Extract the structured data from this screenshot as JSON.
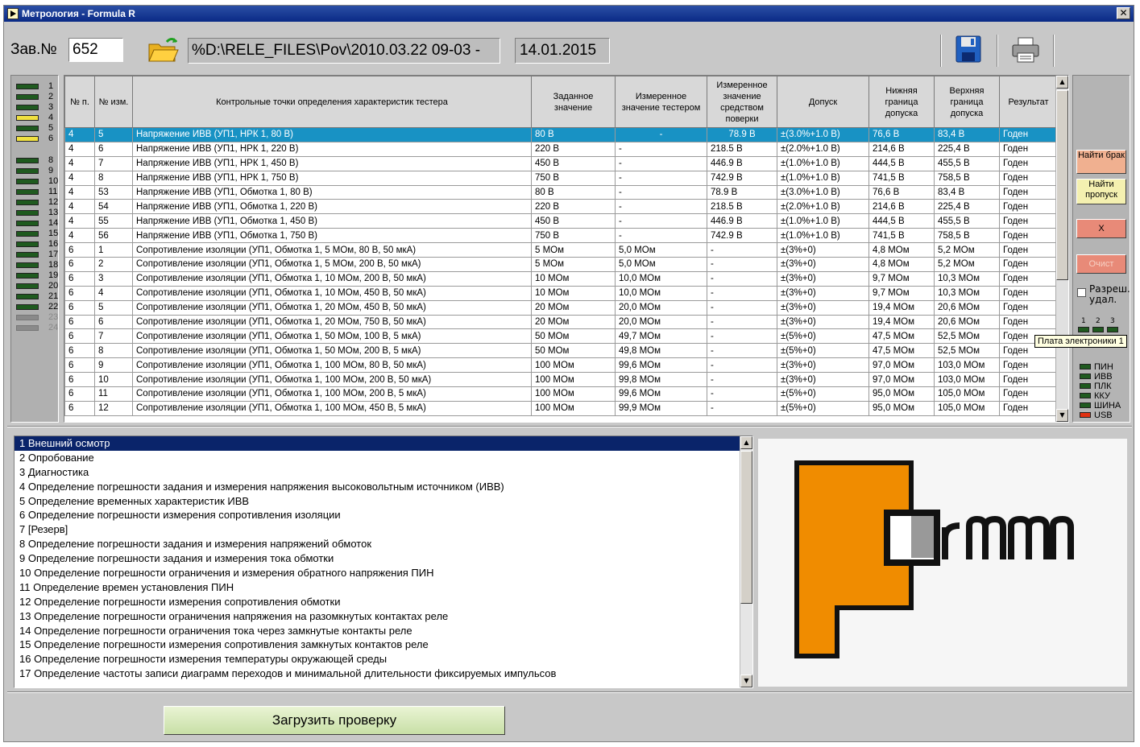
{
  "window": {
    "title": "Метрология - Formula R"
  },
  "toolbar": {
    "zav_label": "Зав.№",
    "zav_value": "652",
    "path": "%D:\\RELE_FILES\\Pov\\2010.03.22 09-03 -",
    "date": "14.01.2015"
  },
  "leds": [
    {
      "num": "1",
      "color": "green"
    },
    {
      "num": "2",
      "color": "green"
    },
    {
      "num": "3",
      "color": "green"
    },
    {
      "num": "4",
      "color": "yellow"
    },
    {
      "num": "5",
      "color": "green"
    },
    {
      "num": "6",
      "color": "yellow"
    },
    {
      "num": "8",
      "color": "green"
    },
    {
      "num": "9",
      "color": "green"
    },
    {
      "num": "10",
      "color": "green"
    },
    {
      "num": "11",
      "color": "green"
    },
    {
      "num": "12",
      "color": "green"
    },
    {
      "num": "13",
      "color": "green"
    },
    {
      "num": "14",
      "color": "green"
    },
    {
      "num": "15",
      "color": "green"
    },
    {
      "num": "16",
      "color": "green"
    },
    {
      "num": "17",
      "color": "green"
    },
    {
      "num": "18",
      "color": "green"
    },
    {
      "num": "19",
      "color": "green"
    },
    {
      "num": "20",
      "color": "green"
    },
    {
      "num": "21",
      "color": "green"
    },
    {
      "num": "22",
      "color": "green"
    },
    {
      "num": "23",
      "color": "gray"
    },
    {
      "num": "24",
      "color": "gray"
    }
  ],
  "table": {
    "headers": [
      "№ п.",
      "№ изм.",
      "Контрольные точки определения характеристик тестера",
      "Заданное значение",
      "Измеренное значение тестером",
      "Измеренное значение средством поверки",
      "Допуск",
      "Нижняя граница допуска",
      "Верхняя граница допуска",
      "Результат"
    ],
    "rows": [
      [
        "4",
        "5",
        "Напряжение ИВВ (УП1, НРК 1, 80 В)",
        "80 В",
        "-",
        "78.9 В",
        "±(3.0%+1.0 В)",
        "76,6 В",
        "83,4 В",
        "Годен"
      ],
      [
        "4",
        "6",
        "Напряжение ИВВ (УП1, НРК 1, 220 В)",
        "220 В",
        "-",
        "218.5 В",
        "±(2.0%+1.0 В)",
        "214,6 В",
        "225,4 В",
        "Годен"
      ],
      [
        "4",
        "7",
        "Напряжение ИВВ (УП1, НРК 1, 450 В)",
        "450 В",
        "-",
        "446.9 В",
        "±(1.0%+1.0 В)",
        "444,5 В",
        "455,5 В",
        "Годен"
      ],
      [
        "4",
        "8",
        "Напряжение ИВВ (УП1, НРК 1, 750 В)",
        "750 В",
        "-",
        "742.9 В",
        "±(1.0%+1.0 В)",
        "741,5 В",
        "758,5 В",
        "Годен"
      ],
      [
        "4",
        "53",
        "Напряжение ИВВ (УП1, Обмотка 1, 80 В)",
        "80 В",
        "-",
        "78.9 В",
        "±(3.0%+1.0 В)",
        "76,6 В",
        "83,4 В",
        "Годен"
      ],
      [
        "4",
        "54",
        "Напряжение ИВВ (УП1, Обмотка 1, 220 В)",
        "220 В",
        "-",
        "218.5 В",
        "±(2.0%+1.0 В)",
        "214,6 В",
        "225,4 В",
        "Годен"
      ],
      [
        "4",
        "55",
        "Напряжение ИВВ (УП1, Обмотка 1, 450 В)",
        "450 В",
        "-",
        "446.9 В",
        "±(1.0%+1.0 В)",
        "444,5 В",
        "455,5 В",
        "Годен"
      ],
      [
        "4",
        "56",
        "Напряжение ИВВ (УП1, Обмотка 1, 750 В)",
        "750 В",
        "-",
        "742.9 В",
        "±(1.0%+1.0 В)",
        "741,5 В",
        "758,5 В",
        "Годен"
      ],
      [
        "6",
        "1",
        "Сопротивление изоляции (УП1, Обмотка 1, 5 МОм, 80 В, 50 мкА)",
        "5 МОм",
        "5,0 МОм",
        "-",
        "±(3%+0)",
        "4,8 МОм",
        "5,2 МОм",
        "Годен"
      ],
      [
        "6",
        "2",
        "Сопротивление изоляции (УП1, Обмотка 1, 5 МОм, 200 В, 50 мкА)",
        "5 МОм",
        "5,0 МОм",
        "-",
        "±(3%+0)",
        "4,8 МОм",
        "5,2 МОм",
        "Годен"
      ],
      [
        "6",
        "3",
        "Сопротивление изоляции (УП1, Обмотка 1, 10 МОм, 200 В, 50 мкА)",
        "10 МОм",
        "10,0 МОм",
        "-",
        "±(3%+0)",
        "9,7 МОм",
        "10,3 МОм",
        "Годен"
      ],
      [
        "6",
        "4",
        "Сопротивление изоляции (УП1, Обмотка 1, 10 МОм, 450 В, 50 мкА)",
        "10 МОм",
        "10,0 МОм",
        "-",
        "±(3%+0)",
        "9,7 МОм",
        "10,3 МОм",
        "Годен"
      ],
      [
        "6",
        "5",
        "Сопротивление изоляции (УП1, Обмотка 1, 20 МОм, 450 В, 50 мкА)",
        "20 МОм",
        "20,0 МОм",
        "-",
        "±(3%+0)",
        "19,4 МОм",
        "20,6 МОм",
        "Годен"
      ],
      [
        "6",
        "6",
        "Сопротивление изоляции (УП1, Обмотка 1, 20 МОм, 750 В, 50 мкА)",
        "20 МОм",
        "20,0 МОм",
        "-",
        "±(3%+0)",
        "19,4 МОм",
        "20,6 МОм",
        "Годен"
      ],
      [
        "6",
        "7",
        "Сопротивление изоляции (УП1, Обмотка 1, 50 МОм, 100 В, 5 мкА)",
        "50 МОм",
        "49,7 МОм",
        "-",
        "±(5%+0)",
        "47,5 МОм",
        "52,5 МОм",
        "Годен"
      ],
      [
        "6",
        "8",
        "Сопротивление изоляции (УП1, Обмотка 1, 50 МОм, 200 В, 5 мкА)",
        "50 МОм",
        "49,8 МОм",
        "-",
        "±(5%+0)",
        "47,5 МОм",
        "52,5 МОм",
        "Годен"
      ],
      [
        "6",
        "9",
        "Сопротивление изоляции (УП1, Обмотка 1, 100 МОм, 80 В, 50 мкА)",
        "100 МОм",
        "99,6 МОм",
        "-",
        "±(3%+0)",
        "97,0 МОм",
        "103,0 МОм",
        "Годен"
      ],
      [
        "6",
        "10",
        "Сопротивление изоляции (УП1, Обмотка 1, 100 МОм, 200 В, 50 мкА)",
        "100 МОм",
        "99,8 МОм",
        "-",
        "±(3%+0)",
        "97,0 МОм",
        "103,0 МОм",
        "Годен"
      ],
      [
        "6",
        "11",
        "Сопротивление изоляции (УП1, Обмотка 1, 100 МОм, 200 В, 5 мкА)",
        "100 МОм",
        "99,6 МОм",
        "-",
        "±(5%+0)",
        "95,0 МОм",
        "105,0 МОм",
        "Годен"
      ],
      [
        "6",
        "12",
        "Сопротивление изоляции (УП1, Обмотка 1, 100 МОм, 450 В, 5 мкА)",
        "100 МОм",
        "99,9 МОм",
        "-",
        "±(5%+0)",
        "95,0 МОм",
        "105,0 МОм",
        "Годен"
      ]
    ]
  },
  "right_panel": {
    "find_brak": "Найти брак",
    "find_propusk": "Найти пропуск",
    "x_button": "X",
    "clear_button": "Очист",
    "allow_delete": "Разреш. удал.",
    "board_leds": [
      "1",
      "2",
      "3"
    ],
    "tooltip": "Плата электроники 1",
    "status": [
      {
        "label": "ПИН",
        "color": "#1f5a1f"
      },
      {
        "label": "ИВВ",
        "color": "#1f5a1f"
      },
      {
        "label": "ПЛК",
        "color": "#1f5a1f"
      },
      {
        "label": "ККУ",
        "color": "#1f5a1f"
      },
      {
        "label": "ШИНА",
        "color": "#1f5a1f"
      },
      {
        "label": "USB",
        "color": "#e03010"
      }
    ]
  },
  "procedures": [
    " 1  Внешний осмотр",
    " 2  Опробование",
    " 3  Диагностика",
    " 4  Определение погрешности задания и измерения напряжения высоковольтным источником (ИВВ)",
    " 5  Определение временных характеристик ИВВ",
    " 6  Определение погрешности измерения сопротивления изоляции",
    " 7  [Резерв]",
    " 8  Определение погрешности задания и измерения напряжений обмоток",
    " 9  Определение погрешности задания и измерения тока обмотки",
    "10 Определение погрешности ограничения и измерения обратного напряжения ПИН",
    "11 Определение времен установления ПИН",
    "12 Определение погрешности измерения сопротивления обмотки",
    "13 Определение погрешности ограничения напряжения на разомкнутых контактах реле",
    "14 Определение погрешности ограничения тока через замкнутые контакты реле",
    "15 Определение погрешности измерения сопротивления замкнутых контактов реле",
    "16 Определение погрешности измерения температуры окружающей среды",
    "17 Определение частоты записи диаграмм переходов и минимальной длительности фиксируемых импульсов"
  ],
  "bottom": {
    "load_button": "Загрузить проверку"
  },
  "colors": {
    "selected_row": "#1892c4",
    "selected_list": "#0a246a",
    "logo_orange": "#f08c00"
  }
}
